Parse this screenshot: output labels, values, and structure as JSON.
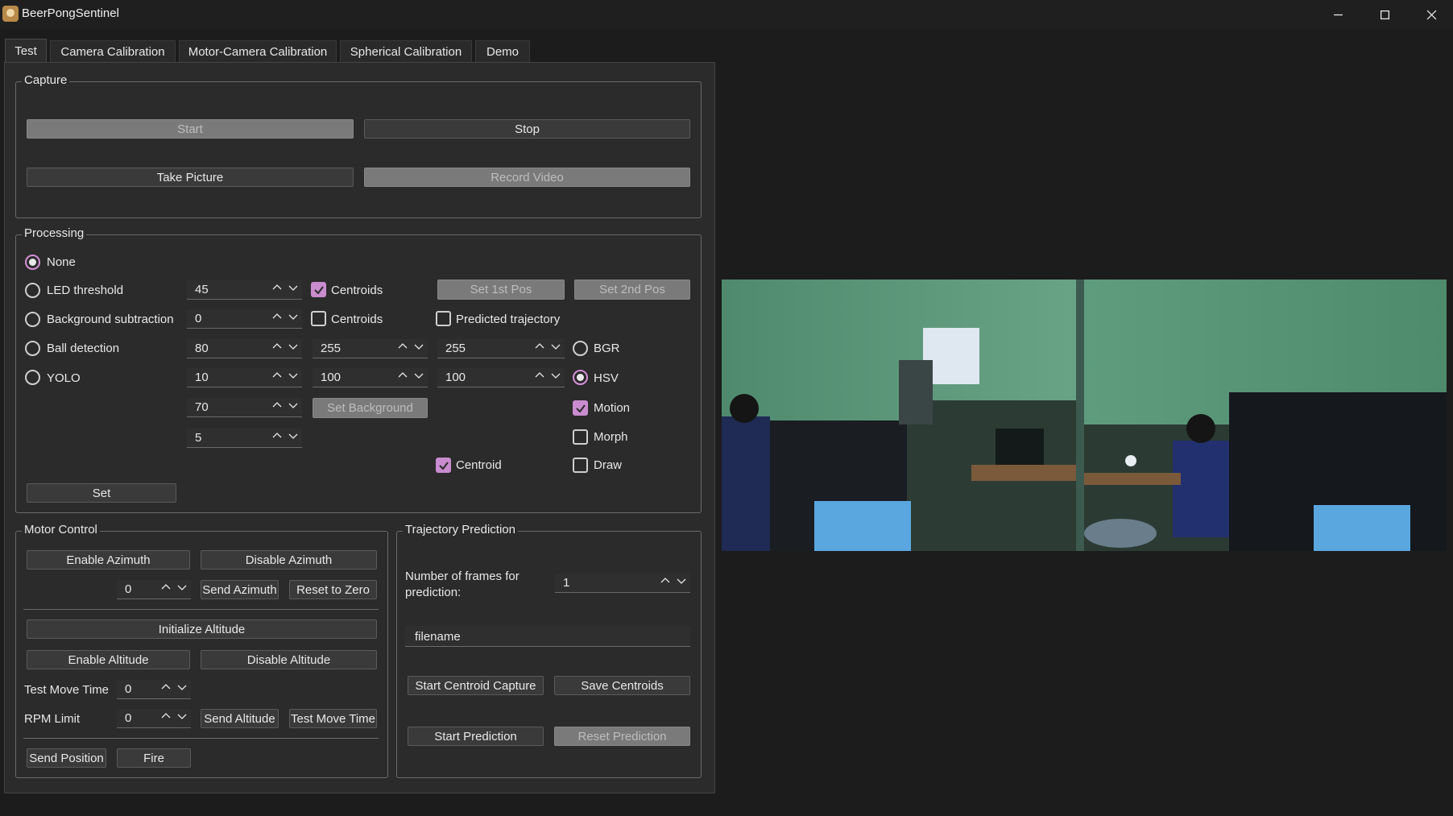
{
  "window": {
    "title": "BeerPongSentinel"
  },
  "tabs": [
    "Test",
    "Camera Calibration",
    "Motor-Camera Calibration",
    "Spherical Calibration",
    "Demo"
  ],
  "capture": {
    "title": "Capture",
    "start": "Start",
    "stop": "Stop",
    "take_picture": "Take Picture",
    "record_video": "Record Video"
  },
  "processing": {
    "title": "Processing",
    "radio_none": "None",
    "radio_led": "LED threshold",
    "radio_bg": "Background subtraction",
    "radio_ball": "Ball detection",
    "radio_yolo": "YOLO",
    "spin_led": "45",
    "spin_bg": "0",
    "spin_ball_1": "80",
    "spin_ball_2": "255",
    "spin_ball_3": "255",
    "spin_yolo_1": "10",
    "spin_yolo_2": "100",
    "spin_yolo_3": "100",
    "spin_extra_1": "70",
    "spin_extra_2": "5",
    "centroids_1": "Centroids",
    "centroids_2": "Centroids",
    "set_1st_pos": "Set 1st Pos",
    "set_2nd_pos": "Set 2nd Pos",
    "predicted_trajectory": "Predicted trajectory",
    "bgr": "BGR",
    "hsv": "HSV",
    "motion": "Motion",
    "morph": "Morph",
    "draw": "Draw",
    "centroid": "Centroid",
    "set_background": "Set Background",
    "set": "Set"
  },
  "motor": {
    "title": "Motor Control",
    "enable_azimuth": "Enable Azimuth",
    "disable_azimuth": "Disable Azimuth",
    "azimuth_value": "0",
    "send_azimuth": "Send Azimuth",
    "reset_to_zero": "Reset to Zero",
    "initialize_altitude": "Initialize Altitude",
    "enable_altitude": "Enable Altitude",
    "disable_altitude": "Disable Altitude",
    "test_move_time_label": "Test Move Time",
    "test_move_time_value": "0",
    "rpm_limit_label": "RPM Limit",
    "rpm_limit_value": "0",
    "send_altitude": "Send Altitude",
    "test_move_time_btn": "Test Move Time",
    "send_position": "Send Position",
    "fire": "Fire"
  },
  "trajectory": {
    "title": "Trajectory Prediction",
    "frames_label_1": "Number of frames for",
    "frames_label_2": "prediction:",
    "frames_value": "1",
    "filename": "filename",
    "start_centroid_capture": "Start Centroid Capture",
    "save_centroids": "Save Centroids",
    "start_prediction": "Start Prediction",
    "reset_prediction": "Reset Prediction"
  },
  "colors": {
    "accent": "#c98ccf",
    "background": "#1c1c1c",
    "panel": "#2b2b2b"
  }
}
